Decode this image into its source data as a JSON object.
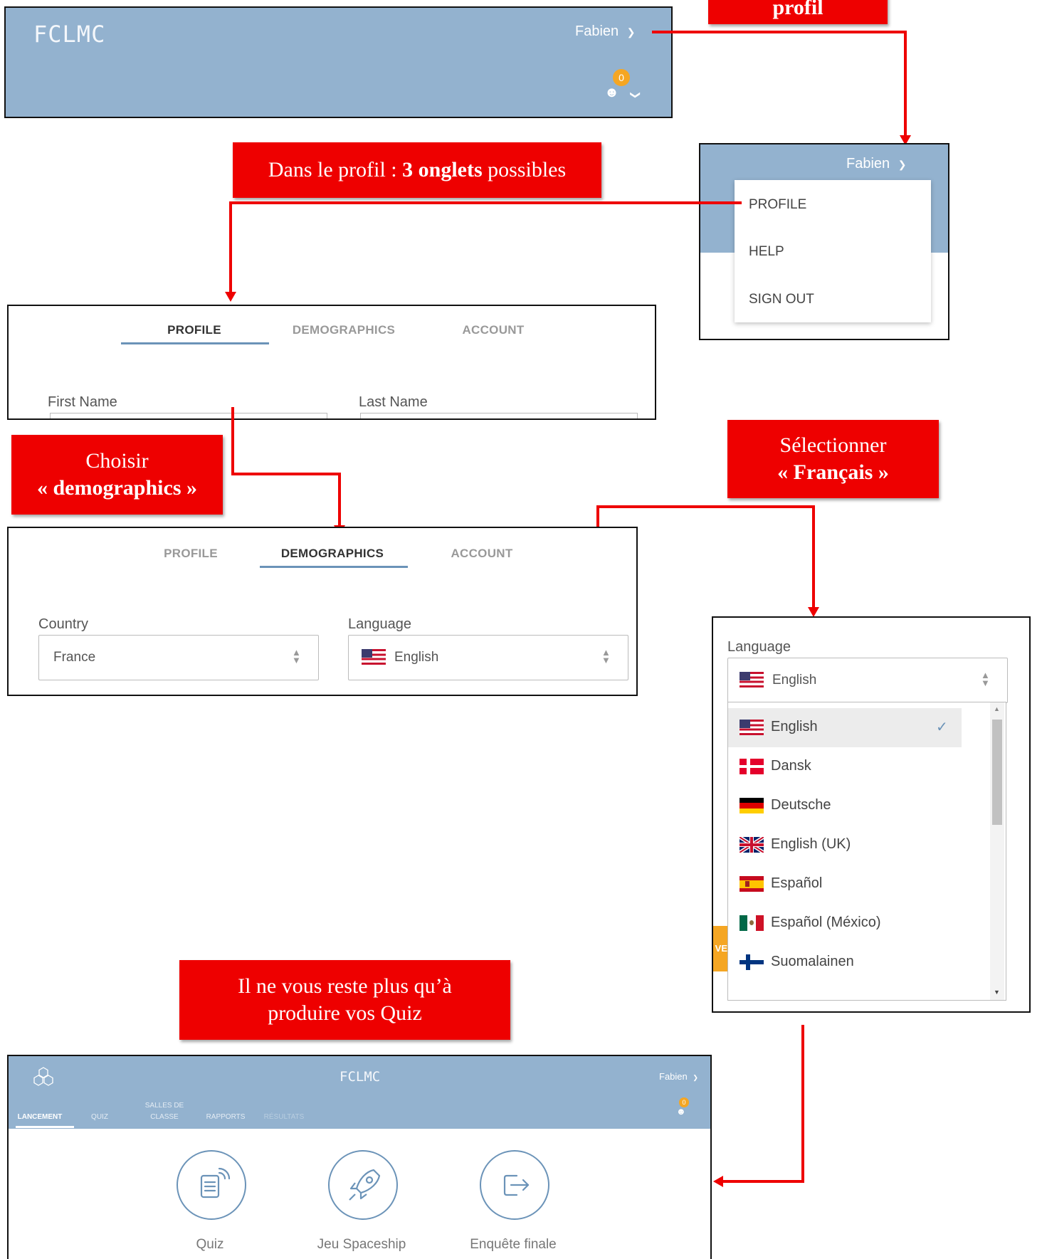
{
  "callouts": {
    "profil": "profil",
    "onglets_prefix": "Dans le profil : ",
    "onglets_bold": "3 onglets",
    "onglets_suffix": " possibles",
    "choisir_line1": "Choisir",
    "choisir_line2": "« demographics »",
    "selectionner_line1": "Sélectionner",
    "selectionner_line2": "« Français »",
    "quiz_line1": "Il ne vous reste plus qu’à",
    "quiz_line2": "produire vos Quiz"
  },
  "header1": {
    "brand": "FCLMC",
    "user": "Fabien",
    "notif_count": "0"
  },
  "user_menu": {
    "user": "Fabien",
    "items": [
      "PROFILE",
      "HELP",
      "SIGN OUT"
    ]
  },
  "profile_tabs": {
    "tabs": [
      "PROFILE",
      "DEMOGRAPHICS",
      "ACCOUNT"
    ],
    "first_name_label": "First Name",
    "last_name_label": "Last Name"
  },
  "demographics": {
    "tabs": [
      "PROFILE",
      "DEMOGRAPHICS",
      "ACCOUNT"
    ],
    "country_label": "Country",
    "country_value": "France",
    "language_label": "Language",
    "language_value": "English"
  },
  "language_dropdown": {
    "label": "Language",
    "selected": "English",
    "options": [
      "English",
      "Dansk",
      "Deutsche",
      "English (UK)",
      "Español",
      "Español (México)",
      "Suomalainen"
    ],
    "partial_button_text": "VE"
  },
  "app": {
    "brand": "FCLMC",
    "user": "Fabien",
    "notif_count": "0",
    "nav": [
      "LANCEMENT",
      "QUIZ",
      "SALLES DE",
      "CLASSE",
      "RAPPORTS",
      "RÉSULTATS"
    ],
    "launch_items": [
      "Quiz",
      "Jeu Spaceship",
      "Enquête finale"
    ]
  },
  "colors": {
    "header_blue": "#93b2cf",
    "callout_red": "#ee0000",
    "accent": "#6b93b8",
    "notif_orange": "#f5a623"
  }
}
